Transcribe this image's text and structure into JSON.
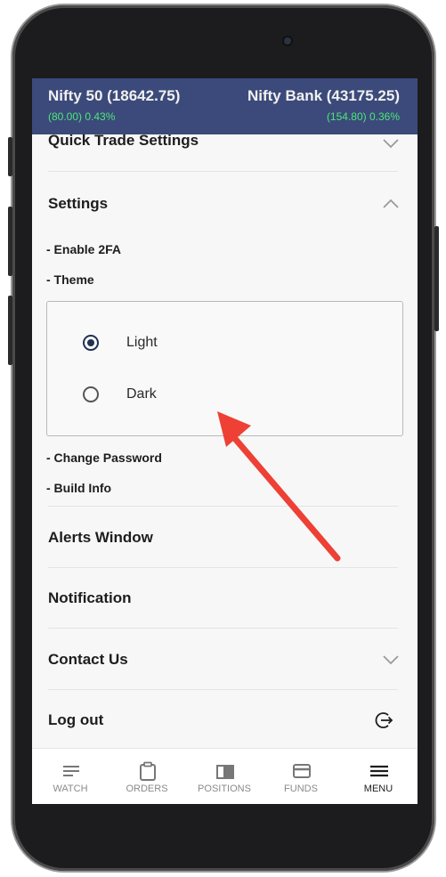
{
  "ticker": {
    "left": {
      "name": "Nifty 50 (18642.75)",
      "change": "(80.00)  0.43%"
    },
    "right": {
      "name": "Nifty Bank (43175.25)",
      "change": "(154.80) 0.36%"
    }
  },
  "menu": {
    "quick_trade": "Quick Trade Settings",
    "settings": "Settings",
    "enable_2fa": "- Enable 2FA",
    "theme": "- Theme",
    "theme_options": {
      "light": "Light",
      "dark": "Dark",
      "selected": "Light"
    },
    "change_password": "- Change Password",
    "build_info": "- Build Info",
    "alerts_window": "Alerts Window",
    "notification": "Notification",
    "contact_us": "Contact Us",
    "log_out": "Log out"
  },
  "bottom_nav": {
    "items": [
      {
        "label": "WATCH",
        "icon": "list-icon"
      },
      {
        "label": "ORDERS",
        "icon": "clipboard-icon"
      },
      {
        "label": "POSITIONS",
        "icon": "book-icon"
      },
      {
        "label": "FUNDS",
        "icon": "card-icon"
      },
      {
        "label": "MENU",
        "icon": "hamburger-icon"
      }
    ],
    "active": "MENU"
  },
  "colors": {
    "ticker_bg": "#3b4a7a",
    "positive_change": "#4ee67a",
    "annotation_arrow": "#ee4035",
    "radio_selected": "#1f3254"
  }
}
